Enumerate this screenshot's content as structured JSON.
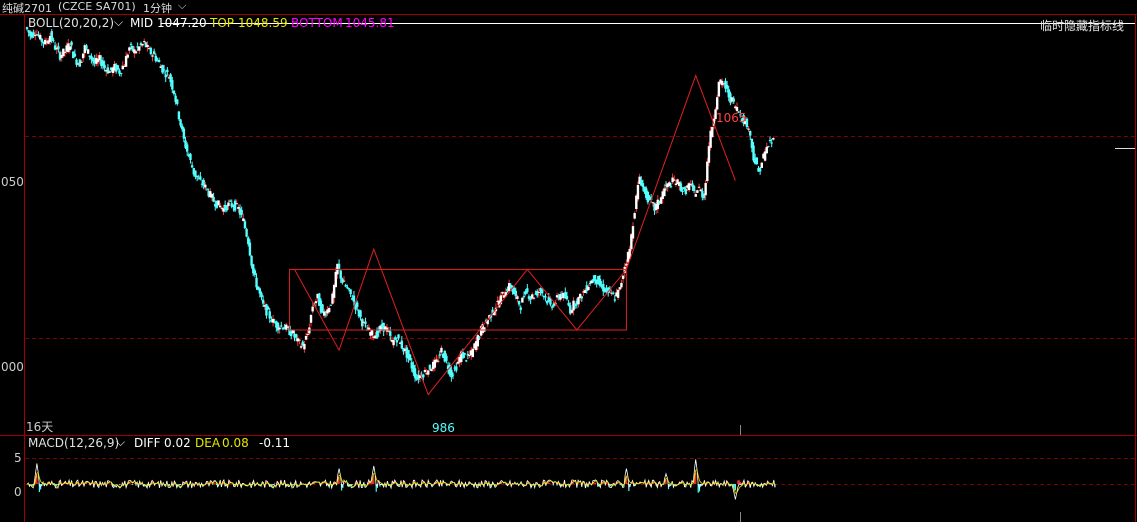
{
  "header": {
    "symbol": "纯碱2701",
    "code": "(CZCE SA701)",
    "period": "1分钟",
    "chevron_icon": "chevron-down-icon"
  },
  "boll": {
    "label": "BOLL(20,20,2)",
    "mid_label": "MID",
    "mid_value": "1047.20",
    "top_label": "TOP",
    "top_value": "1048.59",
    "bottom_label": "BOTTOM",
    "bottom_value": "1045.81",
    "colors": {
      "label": "#e0e0e0",
      "mid": "#ffffff",
      "top": "#e6e600",
      "bottom": "#ff00ff"
    }
  },
  "toolbar": {
    "hide_indicator": "临时隐藏指标线"
  },
  "price_axis": {
    "ticks": [
      "050",
      "000"
    ]
  },
  "annotations": {
    "high": "1065",
    "low": "986",
    "days": "16天"
  },
  "macd": {
    "label": "MACD(12,26,9)",
    "diff_label": "DIFF",
    "diff_value": "0.02",
    "dea_label": "DEA",
    "dea_value": "0.08",
    "macd_value": "-0.11",
    "ticks": [
      "5",
      "0"
    ]
  },
  "colors": {
    "up": "#ff3232",
    "down": "#54ffff",
    "candle_body": "#ffffff",
    "grid": "#800000",
    "pattern": "#e02020",
    "resistance": "#ffffff"
  },
  "chart_data": {
    "type": "line",
    "title": "纯碱2701 1分钟",
    "ylim": [
      976,
      1080
    ],
    "series": [
      {
        "values": [
          1077,
          1075,
          1076,
          1074,
          1073,
          1075,
          1072,
          1070,
          1071,
          1073,
          1069,
          1068,
          1072,
          1070,
          1068,
          1069,
          1067,
          1066,
          1067,
          1066,
          1068,
          1072,
          1071,
          1072,
          1073,
          1071,
          1070,
          1068,
          1066,
          1065,
          1061,
          1055,
          1049,
          1045,
          1041,
          1039,
          1038,
          1036,
          1034,
          1033,
          1032,
          1033,
          1033,
          1032,
          1029,
          1024,
          1016,
          1012,
          1008,
          1006,
          1004,
          1003,
          1003,
          1002,
          1001,
          999,
          998,
          1001,
          1008,
          1010,
          1006,
          1007,
          1010,
          1018,
          1014,
          1012,
          1010,
          1007,
          1004,
          1002,
          1001,
          1001,
          1003,
          1002,
          999,
          1000,
          998,
          996,
          993,
          990,
          991,
          992,
          993,
          994,
          997,
          994,
          991,
          993,
          996,
          995,
          996,
          999,
          1002,
          1004,
          1006,
          1008,
          1010,
          1012,
          1013,
          1010,
          1008,
          1012,
          1010,
          1011,
          1012,
          1010,
          1008,
          1009,
          1011,
          1010,
          1007,
          1009,
          1010,
          1012,
          1014,
          1015,
          1013,
          1012,
          1011,
          1010,
          1012,
          1018,
          1022,
          1032,
          1040,
          1036,
          1034,
          1032,
          1034,
          1037,
          1038,
          1039,
          1038,
          1036,
          1038,
          1036,
          1037,
          1035,
          1048,
          1055,
          1063,
          1063,
          1060,
          1058,
          1056,
          1054,
          1052,
          1045,
          1041,
          1045,
          1048,
          1049
        ]
      }
    ],
    "pattern": {
      "box": {
        "left_index": 53,
        "right_index": 121,
        "top": 1017,
        "bottom": 1002
      },
      "zigzag": [
        {
          "i": 54,
          "v": 1017
        },
        {
          "i": 63,
          "v": 997
        },
        {
          "i": 70,
          "v": 1022
        },
        {
          "i": 81,
          "v": 986
        },
        {
          "i": 101,
          "v": 1017
        },
        {
          "i": 111,
          "v": 1002
        },
        {
          "i": 121,
          "v": 1017
        },
        {
          "i": 135,
          "v": 1065
        },
        {
          "i": 143,
          "v": 1039
        }
      ]
    },
    "resistance_value": 1078,
    "last_price_value": 1047,
    "grid_values": [
      1050,
      1000
    ],
    "macd_ylim": [
      -7,
      7
    ],
    "macd_grid": [
      5,
      0
    ],
    "macd_spikes": [
      {
        "i": 2,
        "v": 4
      },
      {
        "i": 63,
        "v": 3
      },
      {
        "i": 70,
        "v": 3.5
      },
      {
        "i": 121,
        "v": 3
      },
      {
        "i": 129,
        "v": 2
      },
      {
        "i": 135,
        "v": 4.8
      },
      {
        "i": 143,
        "v": -3
      }
    ]
  }
}
